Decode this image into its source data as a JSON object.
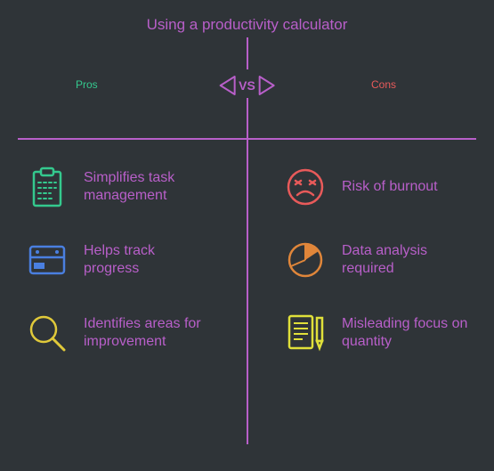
{
  "title": "Using a productivity calculator",
  "vs_label": "VS",
  "pros_header": "Pros",
  "cons_header": "Cons",
  "pros": [
    {
      "text": "Simplifies task management",
      "icon": "clipboard-icon",
      "color": "#34c98e"
    },
    {
      "text": "Helps track progress",
      "icon": "calendar-progress-icon",
      "color": "#4a7fe0"
    },
    {
      "text": "Identifies areas for improvement",
      "icon": "magnify-icon",
      "color": "#e0c93a"
    }
  ],
  "cons": [
    {
      "text": "Risk of burnout",
      "icon": "stressed-face-icon",
      "color": "#e85a5a"
    },
    {
      "text": "Data analysis required",
      "icon": "pie-chart-icon",
      "color": "#e0863a"
    },
    {
      "text": "Misleading focus on quantity",
      "icon": "document-pen-icon",
      "color": "#e0e03a"
    }
  ]
}
